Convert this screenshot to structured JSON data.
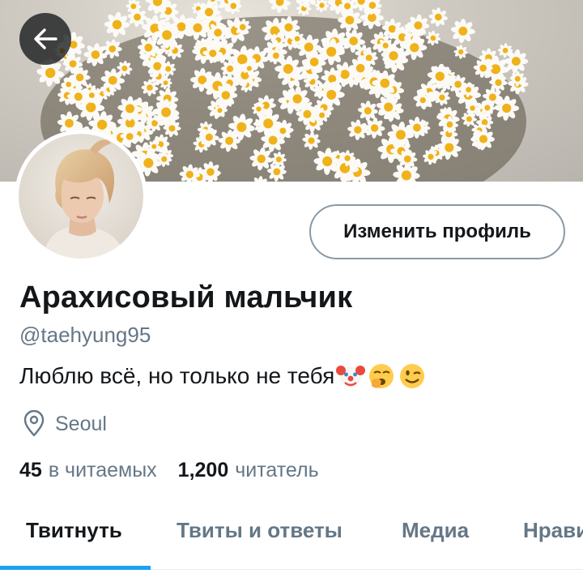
{
  "profile": {
    "display_name": "Арахисовый мальчик",
    "handle": "@taehyung95",
    "bio_text": "Люблю всё, но только не тебя",
    "bio_emojis": [
      "clown-face-emoji",
      "yawning-face-emoji",
      "winking-face-emoji"
    ],
    "location": "Seoul"
  },
  "header": {
    "back_icon": "arrow-left-icon",
    "banner_image": "daisy-bouquet-photo",
    "avatar_image": "profile-photo"
  },
  "actions": {
    "edit_profile_label": "Изменить профиль"
  },
  "stats": {
    "following_count": "45",
    "following_label": "в читаемых",
    "followers_count": "1,200",
    "followers_label": "читатель"
  },
  "tabs": [
    {
      "label": "Твитнуть",
      "active": true
    },
    {
      "label": "Твиты и ответы",
      "active": false
    },
    {
      "label": "Медиа",
      "active": false
    },
    {
      "label": "Нрави",
      "active": false
    }
  ],
  "colors": {
    "accent": "#1da1f2",
    "text_primary": "#14171a",
    "text_secondary": "#657786",
    "button_border": "#8899a6"
  }
}
